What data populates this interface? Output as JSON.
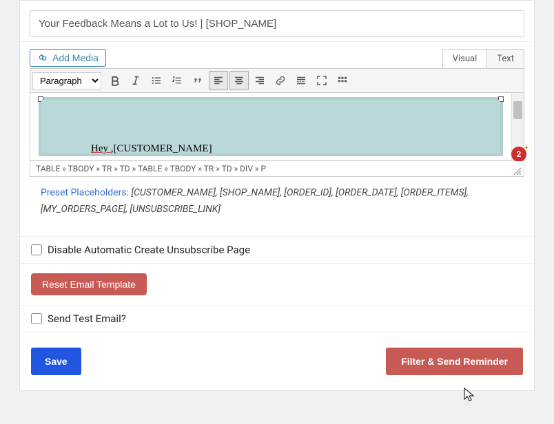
{
  "subject": {
    "value": "Your Feedback Means a Lot to Us! | [SHOP_NAME]"
  },
  "media": {
    "add_label": "Add Media"
  },
  "editor_tabs": {
    "visual": "Visual",
    "text": "Text"
  },
  "format_select": {
    "value": "Paragraph"
  },
  "editor": {
    "content": "Hey ,[CUSTOMER_NAME]",
    "path": "TABLE » TBODY » TR » TD » TABLE » TBODY » TR » TD » DIV » P",
    "badge_count": "2"
  },
  "placeholders": {
    "label": "Preset Placeholders:",
    "values": "[CUSTOMER_NAME], [SHOP_NAME], [ORDER_ID], [ORDER_DATE], [ORDER_ITEMS], [MY_ORDERS_PAGE], [UNSUBSCRIBE_LINK]"
  },
  "checks": {
    "disable_unsub": "Disable Automatic Create Unsubscribe Page",
    "send_test": "Send Test Email?"
  },
  "buttons": {
    "reset": "Reset Email Template",
    "save": "Save",
    "filter_send": "Filter & Send Reminder"
  },
  "colors": {
    "primary": "#2157e0",
    "danger": "#c85a55",
    "link": "#2f6ed1",
    "badge": "#d02c2c"
  }
}
